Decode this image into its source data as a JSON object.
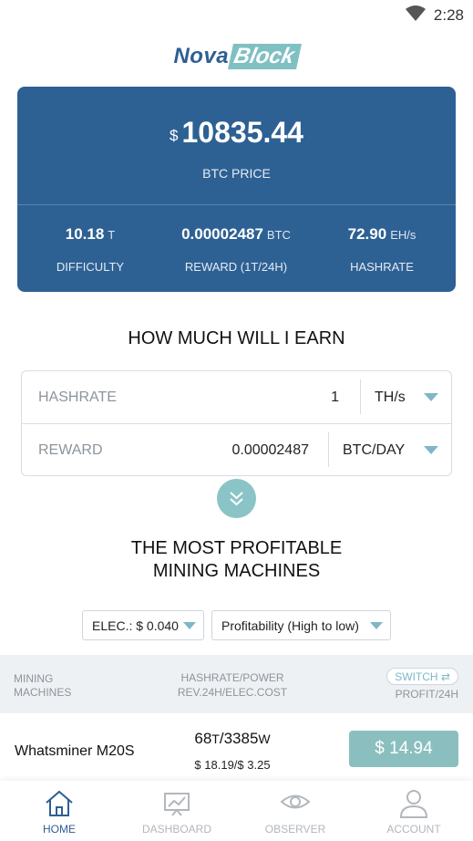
{
  "status_bar": {
    "time": "2:28",
    "wifi_icon": "wifi-icon"
  },
  "brand": {
    "part1": "Nova",
    "part2": "Block"
  },
  "price_card": {
    "currency": "$",
    "btc_price": "10835.44",
    "btc_price_label": "BTC PRICE",
    "stats": [
      {
        "value": "10.18",
        "unit": "T",
        "label": "DIFFICULTY"
      },
      {
        "value": "0.00002487",
        "unit": "BTC",
        "label": "REWARD (1T/24H)"
      },
      {
        "value": "72.90",
        "unit": "EH/s",
        "label": "HASHRATE"
      }
    ]
  },
  "earn": {
    "title": "HOW MUCH WILL I EARN",
    "hashrate_label": "HASHRATE",
    "hashrate_value": "1",
    "hashrate_unit": "TH/s",
    "reward_label": "REWARD",
    "reward_value": "0.00002487",
    "reward_unit": "BTC/DAY"
  },
  "machines": {
    "title_line1": "THE MOST PROFITABLE",
    "title_line2": "MINING MACHINES",
    "elec_filter": "ELEC.: $ 0.040",
    "sort_filter": "Profitability (High to low)",
    "header": {
      "col1_line1": "MINING",
      "col1_line2": "MACHINES",
      "col2_line1": "HASHRATE/POWER",
      "col2_line2": "REV.24H/ELEC.COST",
      "switch_label": "SWITCH",
      "col3": "PROFIT/24H"
    },
    "rows": [
      {
        "name": "Whatsminer M20S",
        "hashrate": "68",
        "hashrate_unit": "T",
        "power": "/3385",
        "power_unit": "W",
        "rev_cost": "$ 18.19/$ 3.25",
        "profit": "$ 14.94"
      }
    ]
  },
  "tabs": [
    {
      "label": "HOME",
      "icon": "home-icon",
      "active": true
    },
    {
      "label": "DASHBOARD",
      "icon": "dashboard-icon",
      "active": false
    },
    {
      "label": "OBSERVER",
      "icon": "eye-icon",
      "active": false
    },
    {
      "label": "ACCOUNT",
      "icon": "user-icon",
      "active": false
    }
  ],
  "colors": {
    "primary": "#2e6193",
    "accent": "#8ac4c6",
    "profit": "#8bbfbf"
  }
}
